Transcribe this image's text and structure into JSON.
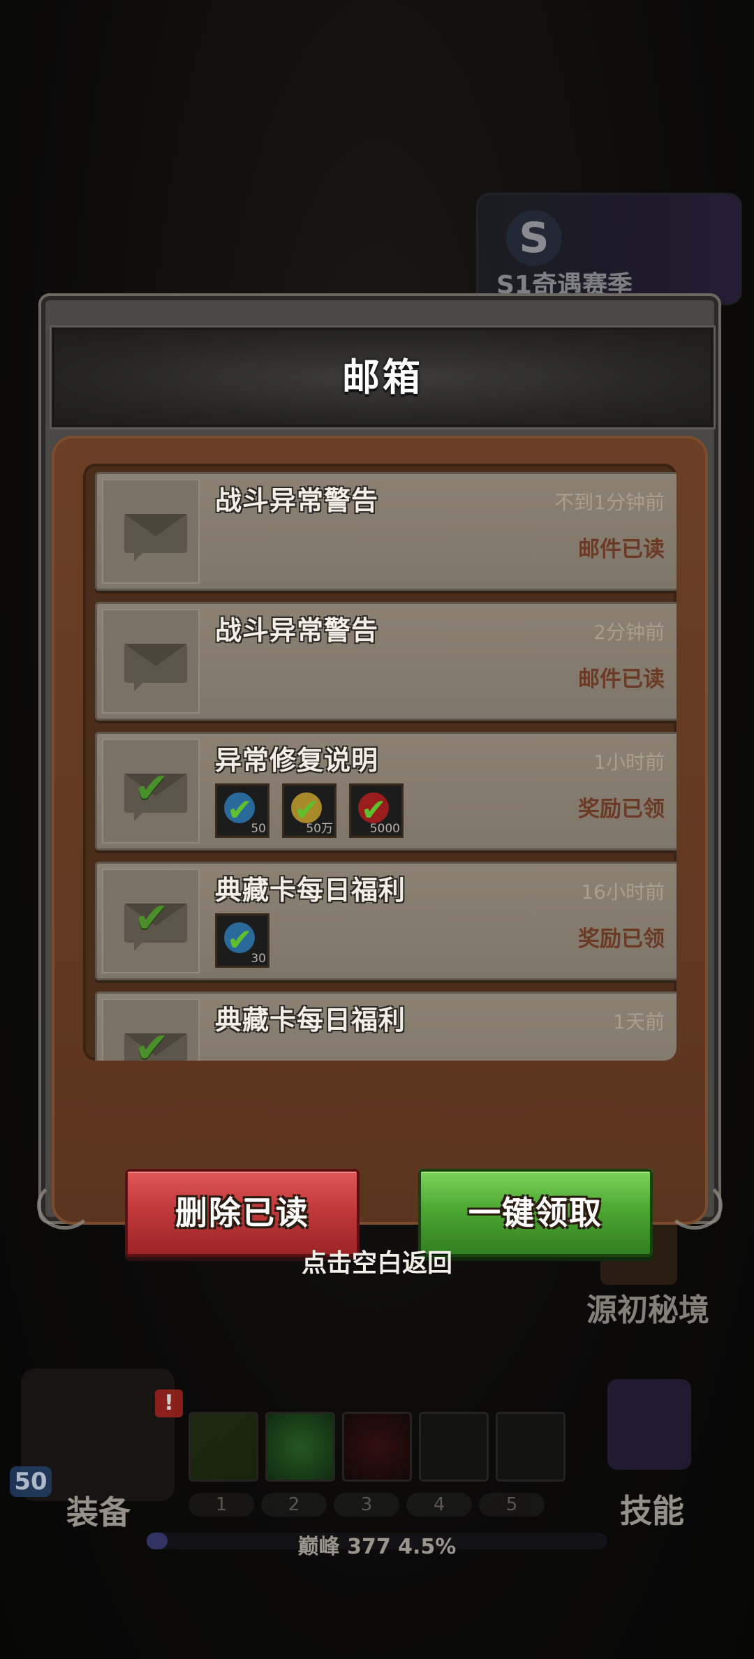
{
  "background": {
    "season_label": "S1奇遇赛季",
    "right_feature_label": "源初秘境",
    "level": "50",
    "alert": "!",
    "equip_label": "装备",
    "skills_label": "技能",
    "slot_numbers": [
      "1",
      "2",
      "3",
      "4",
      "5"
    ],
    "peak_text": "巅峰 377   4.5%",
    "peak_progress": 0.045
  },
  "modal": {
    "title": "邮箱",
    "mails": [
      {
        "title": "战斗异常警告",
        "time": "不到1分钟前",
        "status": "邮件已读",
        "icon": "envelope-icon",
        "rewards": []
      },
      {
        "title": "战斗异常警告",
        "time": "2分钟前",
        "status": "邮件已读",
        "icon": "envelope-icon",
        "rewards": []
      },
      {
        "title": "异常修复说明",
        "time": "1小时前",
        "status": "奖励已领",
        "icon": "envelope-check-icon",
        "rewards": [
          {
            "qty": "50",
            "color": "#2a6a9a"
          },
          {
            "qty": "50万",
            "color": "#a88a2a"
          },
          {
            "qty": "5000",
            "color": "#9a1d1d"
          }
        ]
      },
      {
        "title": "典藏卡每日福利",
        "time": "16小时前",
        "status": "奖励已领",
        "icon": "envelope-check-icon",
        "rewards": [
          {
            "qty": "30",
            "color": "#2a6a9a"
          }
        ]
      },
      {
        "title": "典藏卡每日福利",
        "time": "1天前",
        "status": "",
        "icon": "envelope-check-icon",
        "rewards": []
      }
    ],
    "delete_read_label": "删除已读",
    "claim_all_label": "一键领取"
  },
  "tap_blank_return": "点击空白返回"
}
